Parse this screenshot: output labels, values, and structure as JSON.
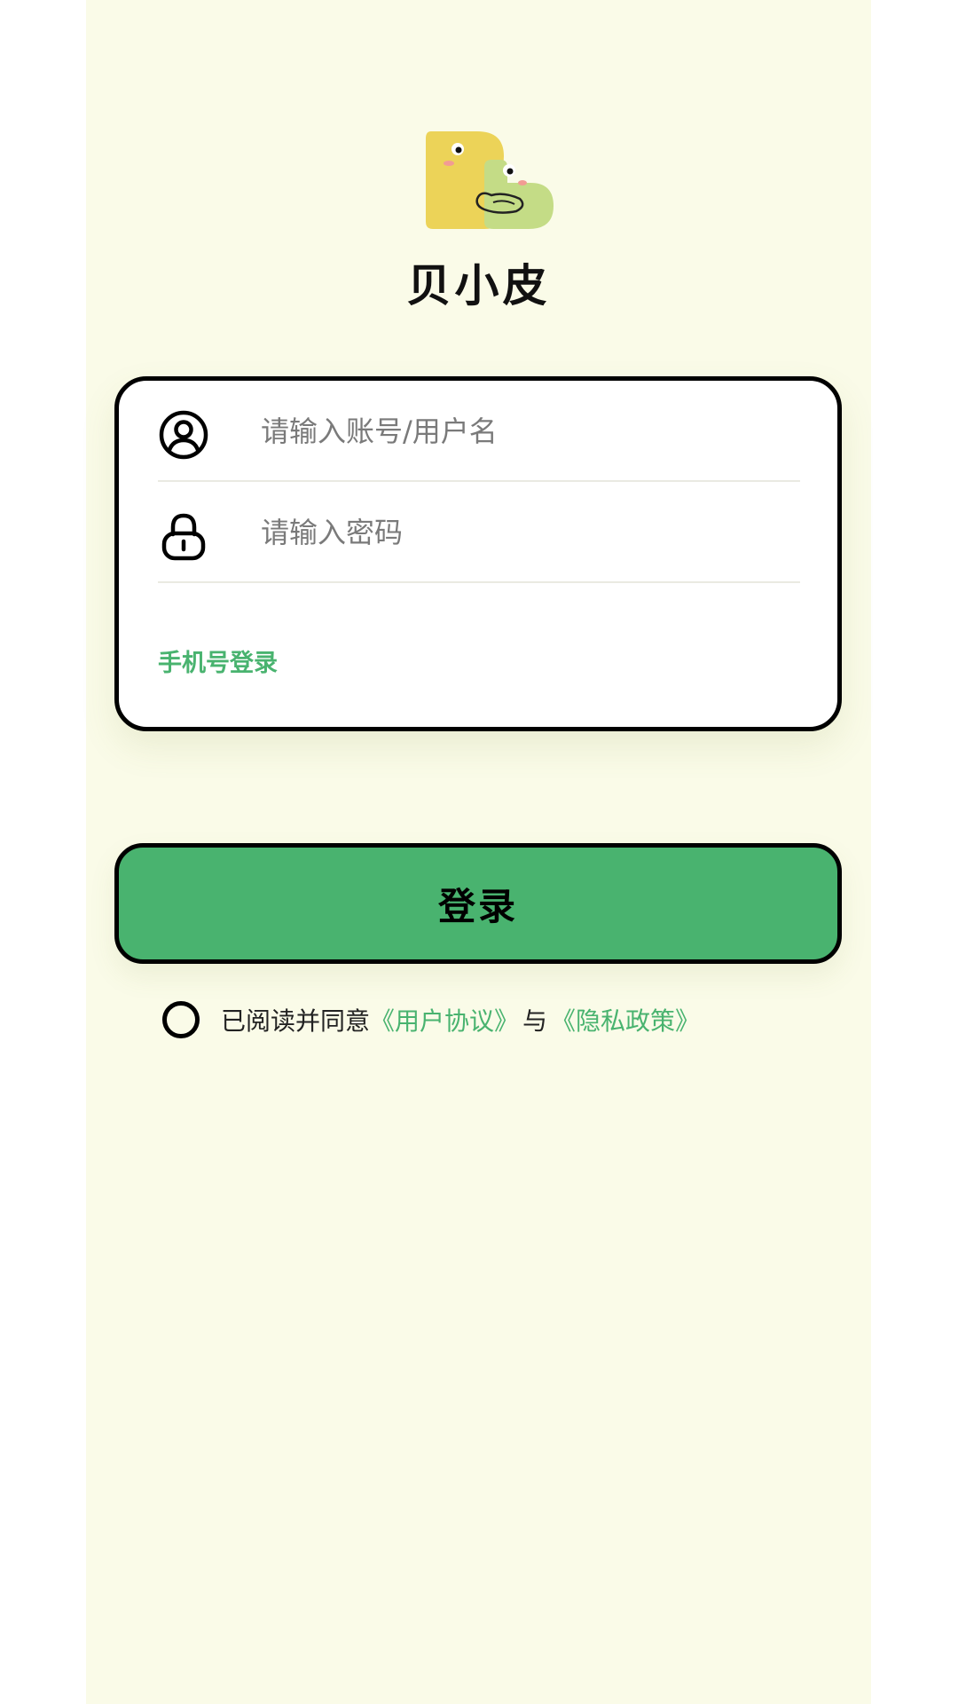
{
  "app": {
    "name": "贝小皮"
  },
  "form": {
    "username_placeholder": "请输入账号/用户名",
    "username_value": "",
    "password_placeholder": "请输入密码",
    "password_value": "",
    "phone_login_label": "手机号登录"
  },
  "actions": {
    "login_label": "登录"
  },
  "agreement": {
    "checked": false,
    "prefix": "已阅读并同意",
    "user_agreement": "《用户协议》",
    "and": "与",
    "privacy_policy": "《隐私政策》"
  },
  "colors": {
    "page_background": "#fafbe8",
    "accent_green": "#49b36f",
    "border": "#000000",
    "logo_yellow": "#ecd358",
    "logo_green": "#c4dc86"
  },
  "icons": {
    "logo": "bb-mascot-logo",
    "username": "user-circle-icon",
    "password": "lock-icon"
  }
}
